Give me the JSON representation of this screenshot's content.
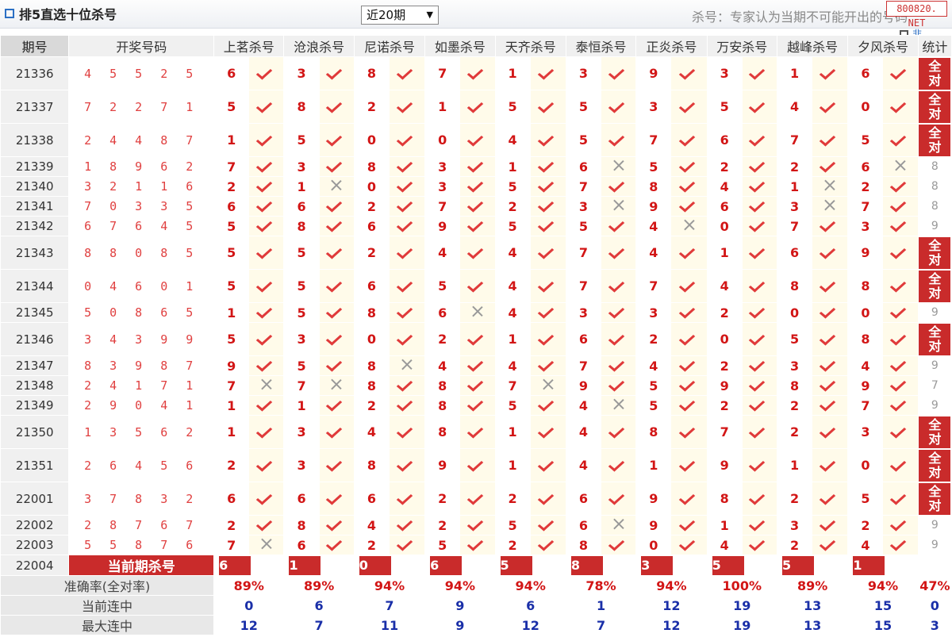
{
  "header": {
    "title": "排5直选十位杀号",
    "period_selected": "近20期",
    "note": "杀号：专家认为当期不可能开出的号码",
    "watermark": "800820. NET",
    "legend": "非"
  },
  "columns": {
    "issue": "期号",
    "draw": "开奖号码",
    "experts": [
      "上茗杀号",
      "沧浪杀号",
      "尼诺杀号",
      "如墨杀号",
      "天齐杀号",
      "泰恒杀号",
      "正炎杀号",
      "万安杀号",
      "越峰杀号",
      "夕风杀号"
    ],
    "stat": "统计"
  },
  "all_correct_label": "全对",
  "rows": [
    {
      "issue": "21336",
      "draw": "4 5 5 2 5",
      "kills": [
        "6",
        "3",
        "8",
        "7",
        "1",
        "3",
        "9",
        "3",
        "1",
        "6"
      ],
      "marks": [
        1,
        1,
        1,
        1,
        1,
        1,
        1,
        1,
        1,
        1
      ],
      "stat": "all"
    },
    {
      "issue": "21337",
      "draw": "7 2 2 7 1",
      "kills": [
        "5",
        "8",
        "2",
        "1",
        "5",
        "5",
        "3",
        "5",
        "4",
        "0"
      ],
      "marks": [
        1,
        1,
        1,
        1,
        1,
        1,
        1,
        1,
        1,
        1
      ],
      "stat": "all"
    },
    {
      "issue": "21338",
      "draw": "2 4 4 8 7",
      "kills": [
        "1",
        "5",
        "0",
        "0",
        "4",
        "5",
        "7",
        "6",
        "7",
        "5"
      ],
      "marks": [
        1,
        1,
        1,
        1,
        1,
        1,
        1,
        1,
        1,
        1
      ],
      "stat": "all"
    },
    {
      "issue": "21339",
      "draw": "1 8 9 6 2",
      "kills": [
        "7",
        "3",
        "8",
        "3",
        "1",
        "6",
        "5",
        "2",
        "2",
        "6"
      ],
      "marks": [
        1,
        1,
        1,
        1,
        1,
        0,
        1,
        1,
        1,
        0
      ],
      "stat": "8"
    },
    {
      "issue": "21340",
      "draw": "3 2 1 1 6",
      "kills": [
        "2",
        "1",
        "0",
        "3",
        "5",
        "7",
        "8",
        "4",
        "1",
        "2"
      ],
      "marks": [
        1,
        0,
        1,
        1,
        1,
        1,
        1,
        1,
        0,
        1
      ],
      "stat": "8"
    },
    {
      "issue": "21341",
      "draw": "7 0 3 3 5",
      "kills": [
        "6",
        "6",
        "2",
        "7",
        "2",
        "3",
        "9",
        "6",
        "3",
        "7"
      ],
      "marks": [
        1,
        1,
        1,
        1,
        1,
        0,
        1,
        1,
        0,
        1
      ],
      "stat": "8"
    },
    {
      "issue": "21342",
      "draw": "6 7 6 4 5",
      "kills": [
        "5",
        "8",
        "6",
        "9",
        "5",
        "5",
        "4",
        "0",
        "7",
        "3"
      ],
      "marks": [
        1,
        1,
        1,
        1,
        1,
        1,
        0,
        1,
        1,
        1
      ],
      "stat": "9"
    },
    {
      "issue": "21343",
      "draw": "8 8 0 8 5",
      "kills": [
        "5",
        "5",
        "2",
        "4",
        "4",
        "7",
        "4",
        "1",
        "6",
        "9"
      ],
      "marks": [
        1,
        1,
        1,
        1,
        1,
        1,
        1,
        1,
        1,
        1
      ],
      "stat": "all"
    },
    {
      "issue": "21344",
      "draw": "0 4 6 0 1",
      "kills": [
        "5",
        "5",
        "6",
        "5",
        "4",
        "7",
        "7",
        "4",
        "8",
        "8"
      ],
      "marks": [
        1,
        1,
        1,
        1,
        1,
        1,
        1,
        1,
        1,
        1
      ],
      "stat": "all"
    },
    {
      "issue": "21345",
      "draw": "5 0 8 6 5",
      "kills": [
        "1",
        "5",
        "8",
        "6",
        "4",
        "3",
        "3",
        "2",
        "0",
        "0"
      ],
      "marks": [
        1,
        1,
        1,
        0,
        1,
        1,
        1,
        1,
        1,
        1
      ],
      "stat": "9"
    },
    {
      "issue": "21346",
      "draw": "3 4 3 9 9",
      "kills": [
        "5",
        "3",
        "0",
        "2",
        "1",
        "6",
        "2",
        "0",
        "5",
        "8"
      ],
      "marks": [
        1,
        1,
        1,
        1,
        1,
        1,
        1,
        1,
        1,
        1
      ],
      "stat": "all"
    },
    {
      "issue": "21347",
      "draw": "8 3 9 8 7",
      "kills": [
        "9",
        "5",
        "8",
        "4",
        "4",
        "7",
        "4",
        "2",
        "3",
        "4"
      ],
      "marks": [
        1,
        1,
        0,
        1,
        1,
        1,
        1,
        1,
        1,
        1
      ],
      "stat": "9"
    },
    {
      "issue": "21348",
      "draw": "2 4 1 7 1",
      "kills": [
        "7",
        "7",
        "8",
        "8",
        "7",
        "9",
        "5",
        "9",
        "8",
        "9"
      ],
      "marks": [
        0,
        0,
        1,
        1,
        0,
        1,
        1,
        1,
        1,
        1
      ],
      "stat": "7"
    },
    {
      "issue": "21349",
      "draw": "2 9 0 4 1",
      "kills": [
        "1",
        "1",
        "2",
        "8",
        "5",
        "4",
        "5",
        "2",
        "2",
        "7"
      ],
      "marks": [
        1,
        1,
        1,
        1,
        1,
        0,
        1,
        1,
        1,
        1
      ],
      "stat": "9"
    },
    {
      "issue": "21350",
      "draw": "1 3 5 6 2",
      "kills": [
        "1",
        "3",
        "4",
        "8",
        "1",
        "4",
        "8",
        "7",
        "2",
        "3"
      ],
      "marks": [
        1,
        1,
        1,
        1,
        1,
        1,
        1,
        1,
        1,
        1
      ],
      "stat": "all"
    },
    {
      "issue": "21351",
      "draw": "2 6 4 5 6",
      "kills": [
        "2",
        "3",
        "8",
        "9",
        "1",
        "4",
        "1",
        "9",
        "1",
        "0"
      ],
      "marks": [
        1,
        1,
        1,
        1,
        1,
        1,
        1,
        1,
        1,
        1
      ],
      "stat": "all"
    },
    {
      "issue": "22001",
      "draw": "3 7 8 3 2",
      "kills": [
        "6",
        "6",
        "6",
        "2",
        "2",
        "6",
        "9",
        "8",
        "2",
        "5"
      ],
      "marks": [
        1,
        1,
        1,
        1,
        1,
        1,
        1,
        1,
        1,
        1
      ],
      "stat": "all"
    },
    {
      "issue": "22002",
      "draw": "2 8 7 6 7",
      "kills": [
        "2",
        "8",
        "4",
        "2",
        "5",
        "6",
        "9",
        "1",
        "3",
        "2"
      ],
      "marks": [
        1,
        1,
        1,
        1,
        1,
        0,
        1,
        1,
        1,
        1
      ],
      "stat": "9"
    },
    {
      "issue": "22003",
      "draw": "5 5 8 7 6",
      "kills": [
        "7",
        "6",
        "2",
        "5",
        "2",
        "8",
        "0",
        "4",
        "2",
        "4"
      ],
      "marks": [
        0,
        1,
        1,
        1,
        1,
        1,
        1,
        1,
        1,
        1
      ],
      "stat": "9"
    }
  ],
  "current": {
    "issue": "22004",
    "label": "当前期杀号",
    "kills": [
      "6",
      "1",
      "0",
      "6",
      "5",
      "8",
      "3",
      "5",
      "5",
      "1"
    ]
  },
  "footer": {
    "accuracy_label": "准确率(全对率)",
    "accuracy": [
      "89%",
      "89%",
      "94%",
      "94%",
      "94%",
      "78%",
      "94%",
      "100%",
      "89%",
      "94%"
    ],
    "accuracy_total": "47%",
    "current_streak_label": "当前连中",
    "current_streak": [
      "0",
      "6",
      "7",
      "9",
      "6",
      "1",
      "12",
      "19",
      "13",
      "15"
    ],
    "current_streak_total": "0",
    "max_streak_label": "最大连中",
    "max_streak": [
      "12",
      "7",
      "11",
      "9",
      "12",
      "7",
      "12",
      "19",
      "13",
      "15"
    ],
    "max_streak_total": "3"
  },
  "colors": {
    "accent_red": "#c92b2b",
    "kill_red": "#d21515",
    "streak_blue": "#1a2fa8"
  }
}
